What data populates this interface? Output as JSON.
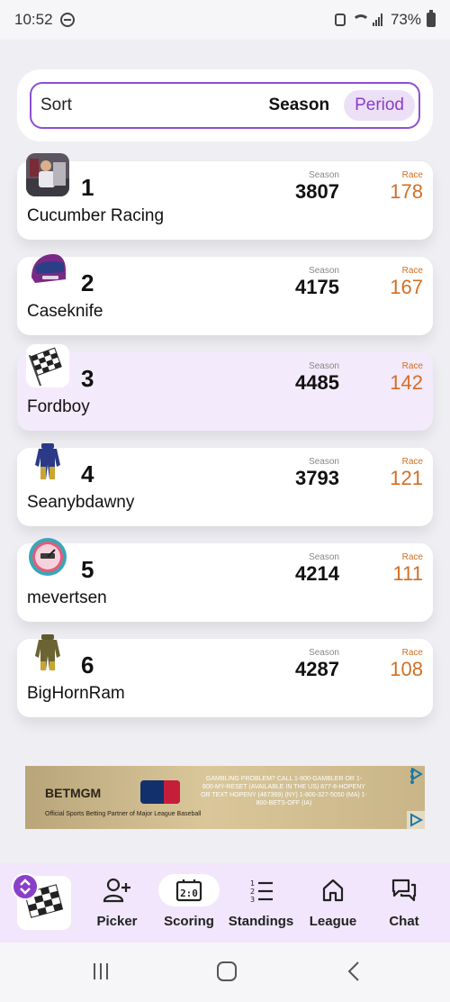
{
  "status_bar": {
    "time": "10:52",
    "battery": "73%"
  },
  "sort": {
    "label": "Sort",
    "options": [
      "Season",
      "Period"
    ],
    "selected": "Period"
  },
  "standings": [
    {
      "rank": "1",
      "team": "Cucumber Racing",
      "season_label": "Season",
      "season": "3807",
      "race_label": "Race",
      "race": "178",
      "highlighted": false
    },
    {
      "rank": "2",
      "team": "Caseknife",
      "season_label": "Season",
      "season": "4175",
      "race_label": "Race",
      "race": "167",
      "highlighted": false
    },
    {
      "rank": "3",
      "team": "Fordboy",
      "season_label": "Season",
      "season": "4485",
      "race_label": "Race",
      "race": "142",
      "highlighted": true
    },
    {
      "rank": "4",
      "team": "Seanybdawny",
      "season_label": "Season",
      "season": "3793",
      "race_label": "Race",
      "race": "121",
      "highlighted": false
    },
    {
      "rank": "5",
      "team": "mevertsen",
      "season_label": "Season",
      "season": "4214",
      "race_label": "Race",
      "race": "111",
      "highlighted": false
    },
    {
      "rank": "6",
      "team": "BigHornRam",
      "season_label": "Season",
      "season": "4287",
      "race_label": "Race",
      "race": "108",
      "highlighted": false
    }
  ],
  "ad": {
    "brand": "BETMGM",
    "tagline": "Official Sports Betting Partner of Major League Baseball",
    "disclaimer": "GAMBLING PROBLEM? CALL 1-800-GAMBLER OR 1-800-MY-RESET (AVAILABLE IN THE US) 877-8-HOPENY OR TEXT HOPENY (467369) (NY) 1-800-327-5050 (MA) 1-800-BETS-OFF (IA)"
  },
  "bottom_nav": {
    "items": [
      {
        "label": "Picker",
        "icon": "add-person-icon",
        "active": false
      },
      {
        "label": "Scoring",
        "icon": "scoreboard-icon",
        "active": true
      },
      {
        "label": "Standings",
        "icon": "ordered-list-icon",
        "active": false
      },
      {
        "label": "League",
        "icon": "home-icon",
        "active": false
      },
      {
        "label": "Chat",
        "icon": "chat-icon",
        "active": false
      }
    ]
  },
  "colors": {
    "accent": "#8a3fc9",
    "race_orange": "#d26f24",
    "highlight_row": "#f3eafb"
  }
}
